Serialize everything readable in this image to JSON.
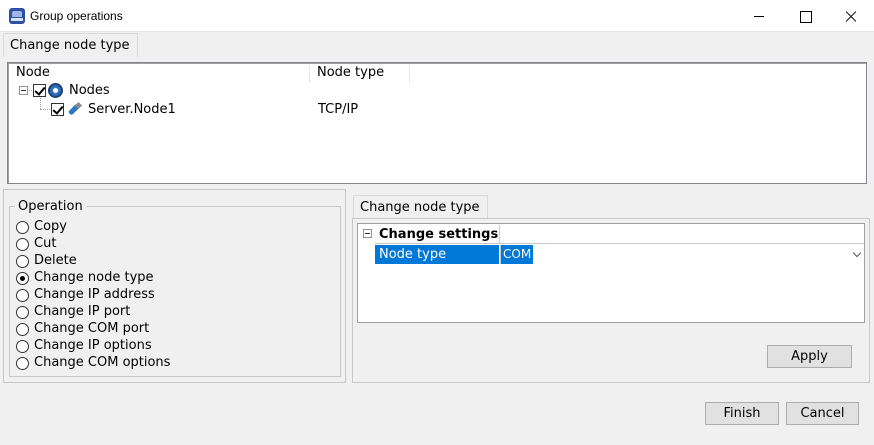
{
  "window": {
    "title": "Group operations"
  },
  "top_tab": {
    "label": "Change node type"
  },
  "tree": {
    "columns": [
      "Node",
      "Node type"
    ],
    "root": {
      "label": "Nodes",
      "checked": true,
      "expanded": true
    },
    "children": [
      {
        "label": "Server.Node1",
        "node_type": "TCP/IP",
        "checked": true
      }
    ]
  },
  "operation": {
    "group_label": "Operation",
    "selected": "Change node type",
    "options": [
      "Copy",
      "Cut",
      "Delete",
      "Change node type",
      "Change IP address",
      "Change IP port",
      "Change COM port",
      "Change IP options",
      "Change COM options"
    ]
  },
  "right_tab": {
    "label": "Change node type"
  },
  "properties": {
    "category": "Change settings",
    "row_name": "Node type",
    "row_value": "COM"
  },
  "buttons": {
    "apply": "Apply",
    "finish": "Finish",
    "cancel": "Cancel"
  },
  "colors": {
    "selection": "#0078d7",
    "window_bg": "#f0f0f0"
  }
}
